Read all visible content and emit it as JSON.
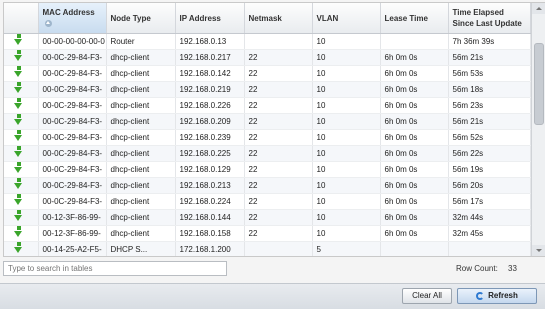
{
  "table": {
    "columns": [
      "",
      "MAC Address",
      "Node Type",
      "IP Address",
      "Netmask",
      "VLAN",
      "Lease Time",
      "Time Elapsed Since Last Update"
    ],
    "rows": [
      [
        "00-00-00-00-00-0",
        "Router",
        "192.168.0.13",
        "",
        "10",
        "",
        "7h 36m 39s"
      ],
      [
        "00-0C-29-84-F3-",
        "dhcp-client",
        "192.168.0.217",
        "22",
        "10",
        "6h 0m 0s",
        "56m 21s"
      ],
      [
        "00-0C-29-84-F3-",
        "dhcp-client",
        "192.168.0.142",
        "22",
        "10",
        "6h 0m 0s",
        "56m 53s"
      ],
      [
        "00-0C-29-84-F3-",
        "dhcp-client",
        "192.168.0.219",
        "22",
        "10",
        "6h 0m 0s",
        "56m 18s"
      ],
      [
        "00-0C-29-84-F3-",
        "dhcp-client",
        "192.168.0.226",
        "22",
        "10",
        "6h 0m 0s",
        "56m 23s"
      ],
      [
        "00-0C-29-84-F3-",
        "dhcp-client",
        "192.168.0.209",
        "22",
        "10",
        "6h 0m 0s",
        "56m 21s"
      ],
      [
        "00-0C-29-84-F3-",
        "dhcp-client",
        "192.168.0.239",
        "22",
        "10",
        "6h 0m 0s",
        "56m 52s"
      ],
      [
        "00-0C-29-84-F3-",
        "dhcp-client",
        "192.168.0.225",
        "22",
        "10",
        "6h 0m 0s",
        "56m 22s"
      ],
      [
        "00-0C-29-84-F3-",
        "dhcp-client",
        "192.168.0.129",
        "22",
        "10",
        "6h 0m 0s",
        "56m 19s"
      ],
      [
        "00-0C-29-84-F3-",
        "dhcp-client",
        "192.168.0.213",
        "22",
        "10",
        "6h 0m 0s",
        "56m 20s"
      ],
      [
        "00-0C-29-84-F3-",
        "dhcp-client",
        "192.168.0.224",
        "22",
        "10",
        "6h 0m 0s",
        "56m 17s"
      ],
      [
        "00-12-3F-86-99-",
        "dhcp-client",
        "192.168.0.144",
        "22",
        "10",
        "6h 0m 0s",
        "32m 44s"
      ],
      [
        "00-12-3F-86-99-",
        "dhcp-client",
        "192.168.0.158",
        "22",
        "10",
        "6h 0m 0s",
        "32m 45s"
      ],
      [
        "00-14-25-A2-F5-",
        "DHCP S...",
        "172.168.1.200",
        "",
        "5",
        "",
        ""
      ]
    ]
  },
  "search": {
    "placeholder": "Type to search in tables"
  },
  "row_count": {
    "label": "Row Count:",
    "value": "33"
  },
  "buttons": {
    "clear_all": "Clear All",
    "refresh": "Refresh"
  },
  "colors": {
    "accent": "#2f7ad1",
    "row_icon": "#3aa52b"
  }
}
